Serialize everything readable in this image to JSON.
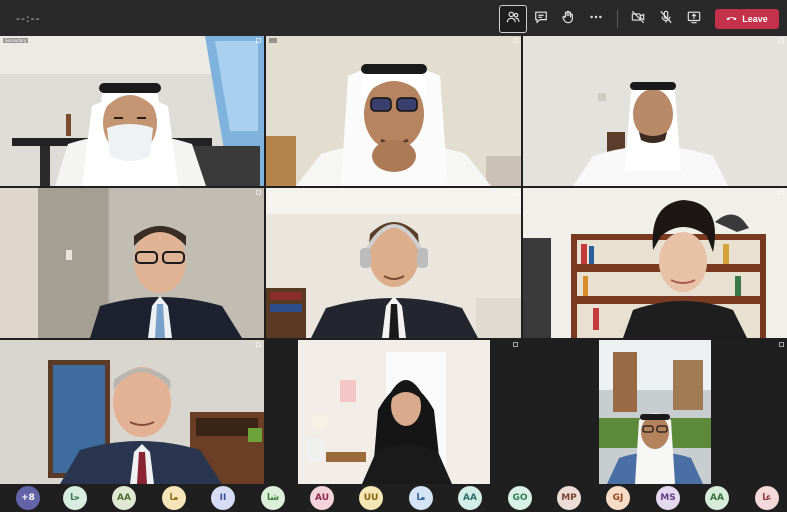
{
  "toolbar": {
    "timer": "--:--",
    "leave_label": "Leave",
    "icons": [
      "participants-icon",
      "chat-icon",
      "raise-hand-icon",
      "more-icon",
      "camera-off-icon",
      "mic-off-icon",
      "share-screen-icon"
    ]
  },
  "tiles": [
    {
      "name": "",
      "top": "Secondary"
    },
    {
      "name": "",
      "top": "..."
    },
    {
      "name": "",
      "top": ""
    },
    {
      "name": "",
      "top": ""
    },
    {
      "name": "",
      "top": ""
    },
    {
      "name": "",
      "top": ""
    },
    {
      "name": "",
      "top": ""
    },
    {
      "name": "",
      "top": ""
    },
    {
      "name": "",
      "top": ""
    },
    {
      "name": "",
      "top": ""
    }
  ],
  "participants": {
    "overflow_label": "+8",
    "avatars": [
      {
        "initials": "حا",
        "bg": "#d8ecdf",
        "fg": "#3b7a55"
      },
      {
        "initials": "AA",
        "bg": "#dfe8d2",
        "fg": "#556b2f"
      },
      {
        "initials": "ما",
        "bg": "#f5e5b8",
        "fg": "#8a6a13"
      },
      {
        "initials": "II",
        "bg": "#d6dcf3",
        "fg": "#3c4f9a"
      },
      {
        "initials": "شا",
        "bg": "#dcefd8",
        "fg": "#3d7a3a"
      },
      {
        "initials": "AU",
        "bg": "#f3d3dc",
        "fg": "#8f2b4a"
      },
      {
        "initials": "UU",
        "bg": "#f5e6b5",
        "fg": "#85650f"
      },
      {
        "initials": "ما",
        "bg": "#d4e4f5",
        "fg": "#2f5f91"
      },
      {
        "initials": "AA",
        "bg": "#d2ece8",
        "fg": "#2b6e66"
      },
      {
        "initials": "GO",
        "bg": "#d9f0e6",
        "fg": "#2f7a58"
      },
      {
        "initials": "MP",
        "bg": "#ecdcd6",
        "fg": "#7a4534"
      },
      {
        "initials": "GJ",
        "bg": "#f7dcc8",
        "fg": "#94471b"
      },
      {
        "initials": "MS",
        "bg": "#e5d9ef",
        "fg": "#643c86"
      },
      {
        "initials": "AA",
        "bg": "#d6ecd9",
        "fg": "#356f3e"
      },
      {
        "initials": "غا",
        "bg": "#f3d9d9",
        "fg": "#8d3434"
      }
    ]
  },
  "colors": {
    "leave": "#c4314b",
    "topbar": "#292929",
    "background": "#1f1f1f"
  }
}
